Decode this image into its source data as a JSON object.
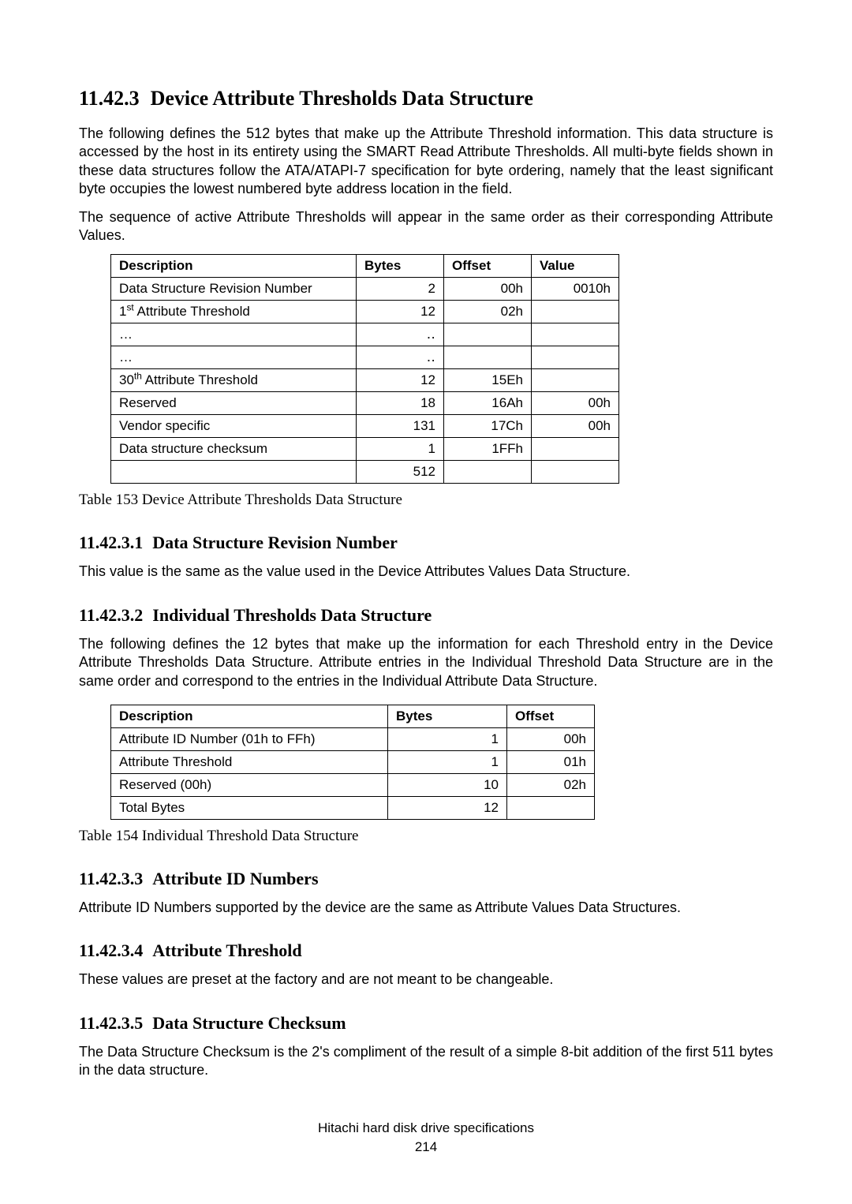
{
  "section": {
    "num": "11.42.3",
    "title": "Device Attribute Thresholds Data Structure",
    "para1": "The following defines the 512 bytes that make up the Attribute Threshold information. This data structure is accessed by the host in its entirety using the SMART Read Attribute Thresholds. All multi-byte fields shown in these data structures follow the ATA/ATAPI-7 specification for byte ordering, namely that the least significant byte occupies the lowest numbered byte address location in the field.",
    "para2": "The sequence of active Attribute Thresholds will appear in the same order as their corresponding Attribute Values."
  },
  "table153": {
    "headers": {
      "c1": "Description",
      "c2": "Bytes",
      "c3": "Offset",
      "c4": "Value"
    },
    "rows": {
      "r0": {
        "desc": "Data Structure Revision Number",
        "bytes": "2",
        "offset": "00h",
        "value": "0010h"
      },
      "r1": {
        "desc_pre": "1",
        "desc_sup": "st",
        "desc_post": " Attribute Threshold",
        "bytes": "12",
        "offset": "02h",
        "value": ""
      },
      "r2": {
        "desc": "…",
        "bytes": "‥",
        "offset": "",
        "value": ""
      },
      "r3": {
        "desc": "…",
        "bytes": "‥",
        "offset": "",
        "value": ""
      },
      "r4": {
        "desc_pre": "30",
        "desc_sup": "th",
        "desc_post": " Attribute Threshold",
        "bytes": "12",
        "offset": "15Eh",
        "value": ""
      },
      "r5": {
        "desc": "Reserved",
        "bytes": "18",
        "offset": "16Ah",
        "value": "00h"
      },
      "r6": {
        "desc": "Vendor specific",
        "bytes": "131",
        "offset": "17Ch",
        "value": "00h"
      },
      "r7": {
        "desc": "Data structure checksum",
        "bytes": "1",
        "offset": "1FFh",
        "value": ""
      },
      "r8": {
        "desc": "",
        "bytes": "512",
        "offset": "",
        "value": ""
      }
    },
    "caption": "Table 153    Device Attribute Thresholds Data Structure"
  },
  "s1": {
    "num": "11.42.3.1",
    "title": "Data Structure Revision Number",
    "para": "This value is the same as the value used in the Device Attributes Values Data Structure."
  },
  "s2": {
    "num": "11.42.3.2",
    "title": "Individual Thresholds Data Structure",
    "para": "The following defines the 12 bytes that make up the information for each Threshold entry in the Device Attribute Thresholds Data Structure. Attribute entries in the Individual Threshold Data Structure are in the same order and correspond to the entries in the Individual Attribute Data Structure."
  },
  "table154": {
    "headers": {
      "c1": "Description",
      "c2": "Bytes",
      "c3": "Offset"
    },
    "rows": {
      "r0": {
        "desc": "Attribute ID Number (01h to FFh)",
        "bytes": "1",
        "offset": "00h"
      },
      "r1": {
        "desc": "Attribute Threshold",
        "bytes": "1",
        "offset": "01h"
      },
      "r2": {
        "desc": "Reserved (00h)",
        "bytes": "10",
        "offset": "02h"
      },
      "r3": {
        "desc": "Total Bytes",
        "bytes": "12",
        "offset": ""
      }
    },
    "caption": "Table 154    Individual Threshold Data Structure"
  },
  "s3": {
    "num": "11.42.3.3",
    "title": "Attribute ID Numbers",
    "para": "Attribute ID Numbers supported by the device are the same as Attribute Values Data Structures."
  },
  "s4": {
    "num": "11.42.3.4",
    "title": "Attribute Threshold",
    "para": "These values are preset at the factory and are not meant to be changeable."
  },
  "s5": {
    "num": "11.42.3.5",
    "title": "Data Structure Checksum",
    "para": "The Data Structure Checksum is the 2's compliment of the result of a simple 8-bit addition of the first 511 bytes in the data structure."
  },
  "footer": {
    "line1": "Hitachi hard disk drive specifications",
    "line2": "214"
  }
}
